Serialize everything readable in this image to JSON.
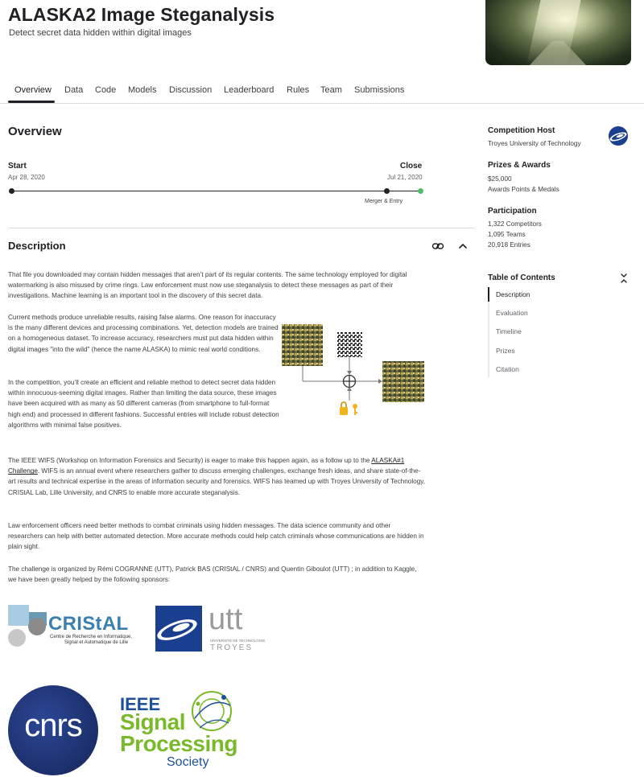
{
  "header": {
    "title": "ALASKA2 Image Steganalysis",
    "subtitle": "Detect secret data hidden within digital images"
  },
  "tabs": [
    {
      "label": "Overview"
    },
    {
      "label": "Data"
    },
    {
      "label": "Code"
    },
    {
      "label": "Models"
    },
    {
      "label": "Discussion"
    },
    {
      "label": "Leaderboard"
    },
    {
      "label": "Rules"
    },
    {
      "label": "Team"
    },
    {
      "label": "Submissions"
    }
  ],
  "overview": {
    "heading": "Overview",
    "start_label": "Start",
    "start_date": "Apr 28, 2020",
    "close_label": "Close",
    "close_date": "Jul 21, 2020",
    "event_label": "Merger & Entry"
  },
  "description": {
    "heading": "Description",
    "p1": "That file you downloaded may contain hidden messages that aren’t part of its regular contents. The same technology employed for digital watermarking is also misused by crime rings. Law enforcement must now use steganalysis to detect these messages as part of their investigations. Machine learning is an important tool in the discovery of this secret data.",
    "p2": "Current methods produce unreliable results, raising false alarms. One reason for inaccuracy is the many different devices and processing combinations. Yet, detection models are trained on a homogeneous dataset. To increase accuracy, researchers must put data hidden within digital images \"into the wild\" (hence the name ALASKA) to mimic real world conditions.",
    "p3": "In the competition, you’ll create an efficient and reliable method to detect secret data hidden within innocuous-seeming digital images. Rather than limiting the data source, these images have been acquired with as many as 50 different cameras (from smartphone to full-format high end) and processed in different fashions. Successful entries will include robust detection algorithms with minimal false positives.",
    "p4_before": "The IEEE WIFS (Workshop on Information Forensics and Security) is eager to make this happen again, as a follow up to the ",
    "p4_link": "ALASKA#1 Challenge",
    "p4_after": ". WIFS is an annual event where researchers gather to discuss emerging challenges, exchange fresh ideas, and share state-of-the-art results and technical expertise in the areas of information security and forensics. WIFS has teamed up with Troyes University of Technology, CRIStAL Lab, Lille University, and CNRS to enable more accurate steganalysis.",
    "p5": "Law enforcement officers need better methods to combat criminals using hidden messages. The data science community and other researchers can help with better automated detection. More accurate methods could help catch criminals whose communications are hidden in plain sight.",
    "p6": "The challenge is organized by Rémi COGRANNE (UTT), Patrick BAS (CRIStAL / CNRS) and Quentin Giboulot (UTT) ; in addition to Kaggle, we have been greatly helped by the following sponsors:"
  },
  "logos": {
    "cristal_name": "CRIStAL",
    "cristal_tag1": "Centre de Recherche en Informatique,",
    "cristal_tag2": "Signal et Automatique de Lille",
    "utt_name": "utt",
    "utt_tag": "UNIVERSITÉ DE TECHNOLOGIE",
    "utt_city": "TROYES",
    "cnrs_name": "cnrs",
    "ieee_top": "IEEE",
    "ieee_line1": "Signal",
    "ieee_line2": "Processing",
    "ieee_line3": "Society"
  },
  "sidebar": {
    "host_heading": "Competition Host",
    "host_name": "Troyes University of Technology",
    "prizes_heading": "Prizes & Awards",
    "prize_amount": "$25,000",
    "prize_note": "Awards Points & Medals",
    "participation_heading": "Participation",
    "competitors": "1,322 Competitors",
    "teams": "1,095 Teams",
    "entries": "20,918 Entries",
    "toc_heading": "Table of Contents",
    "toc": [
      "Description",
      "Evaluation",
      "Timeline",
      "Prizes",
      "Citation"
    ]
  },
  "colors": {
    "accent_green": "#4dbd6b",
    "utt_blue": "#1b3f8f",
    "cnrs_blue": "#1c2f6b",
    "ieee_green": "#7ab929",
    "ieee_blue": "#1e4f9c"
  }
}
